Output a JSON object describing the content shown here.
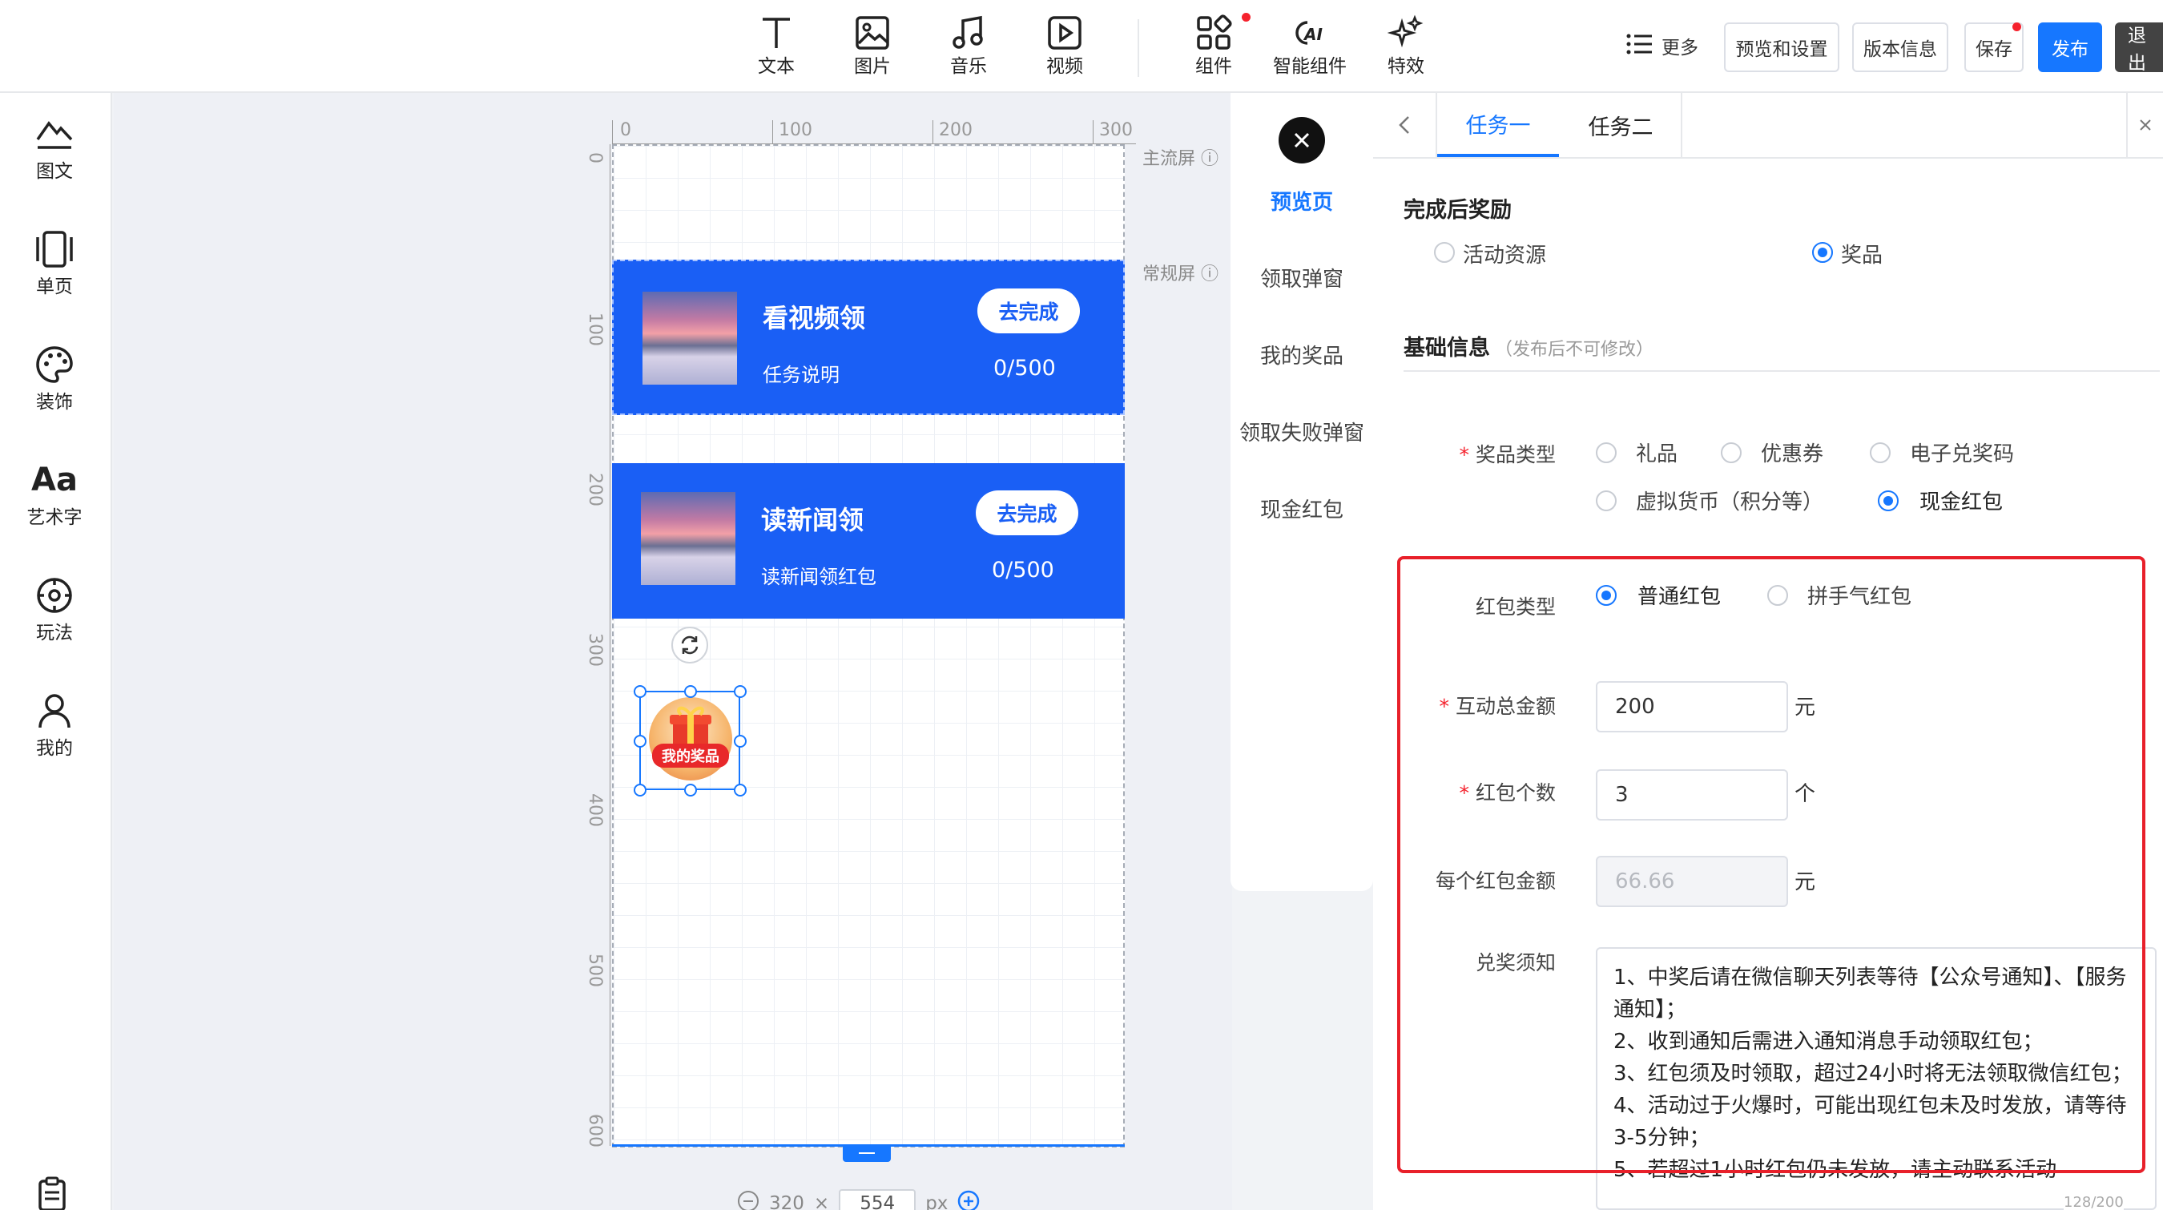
{
  "toolbar": {
    "tools": [
      {
        "label": "文本",
        "icon": "text-icon"
      },
      {
        "label": "图片",
        "icon": "image-icon"
      },
      {
        "label": "音乐",
        "icon": "music-icon"
      },
      {
        "label": "视频",
        "icon": "video-icon"
      },
      {
        "label": "组件",
        "icon": "component-icon"
      },
      {
        "label": "智能组件",
        "icon": "ai-icon"
      },
      {
        "label": "特效",
        "icon": "sparkle-icon"
      }
    ],
    "more": "更多",
    "preview_settings": "预览和设置",
    "version_info": "版本信息",
    "save": "保存",
    "publish": "发布",
    "exit": "退出"
  },
  "sidebar": {
    "items": [
      {
        "label": "图文",
        "icon": "mountain-text-icon"
      },
      {
        "label": "单页",
        "icon": "page-icon"
      },
      {
        "label": "装饰",
        "icon": "palette-icon"
      },
      {
        "label": "艺术字",
        "icon": "art-font-icon"
      },
      {
        "label": "玩法",
        "icon": "compass-icon"
      },
      {
        "label": "我的",
        "icon": "user-icon"
      }
    ]
  },
  "canvas": {
    "ruler_h": [
      "0",
      "100",
      "200",
      "300"
    ],
    "ruler_v": [
      "0",
      "100",
      "200",
      "300",
      "400",
      "500",
      "600"
    ],
    "main_screen": "主流屏",
    "normal_screen": "常规屏",
    "tasks": [
      {
        "title": "看视频领",
        "subtitle": "任务说明",
        "button": "去完成",
        "progress": "0/500"
      },
      {
        "title": "读新闻领",
        "subtitle": "读新闻领红包",
        "button": "去完成",
        "progress": "0/500"
      }
    ],
    "prize_badge": "我的奖品",
    "size_w": "320",
    "size_x": "×",
    "size_h": "554",
    "size_unit": "px"
  },
  "preview_tabs": [
    "预览页",
    "领取弹窗",
    "我的奖品",
    "领取失败弹窗",
    "现金红包"
  ],
  "panel": {
    "tabs": [
      "任务一",
      "任务二"
    ],
    "reward_title": "完成后奖励",
    "reward_options": [
      "活动资源",
      "奖品"
    ],
    "basic_title": "基础信息",
    "basic_hint": "（发布后不可修改）",
    "prize_type_label": "奖品类型",
    "prize_types": [
      "礼品",
      "优惠券",
      "电子兑奖码",
      "虚拟货币（积分等）",
      "现金红包"
    ],
    "redpack_type_label": "红包类型",
    "redpack_types": [
      "普通红包",
      "拼手气红包"
    ],
    "total_label": "互动总金额",
    "total_value": "200",
    "total_unit": "元",
    "count_label": "红包个数",
    "count_value": "3",
    "count_unit": "个",
    "each_label": "每个红包金额",
    "each_value": "66.66",
    "each_unit": "元",
    "notice_label": "兑奖须知",
    "notice_lines": [
      "1、中奖后请在微信聊天列表等待【公众号通知】、【服务通知】；",
      "2、收到通知后需进入通知消息手动领取红包；",
      "3、红包须及时领取，超过24小时将无法领取微信红包；",
      "4、活动过于火爆时，可能出现红包未及时发放，请等待3-5分钟；",
      "5、若超过1小时红包仍未发放，请主动联系活动"
    ],
    "notice_count": "128/200"
  }
}
